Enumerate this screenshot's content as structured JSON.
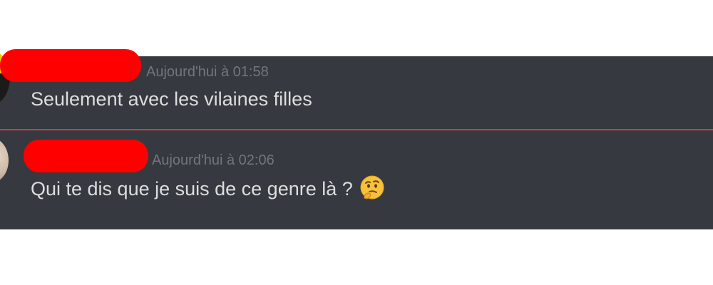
{
  "messages": [
    {
      "timestamp": "Aujourd'hui à 01:58",
      "text": "Seulement avec les vilaines filles"
    },
    {
      "timestamp": "Aujourd'hui à 02:06",
      "text": "Qui te dis que je suis de ce genre là ?",
      "emoji": "thinking-face-icon"
    }
  ],
  "colors": {
    "background": "#36393f",
    "text": "#dcddde",
    "timestamp": "#72767d",
    "new_divider": "#d9383c",
    "redaction": "#ff0000"
  }
}
